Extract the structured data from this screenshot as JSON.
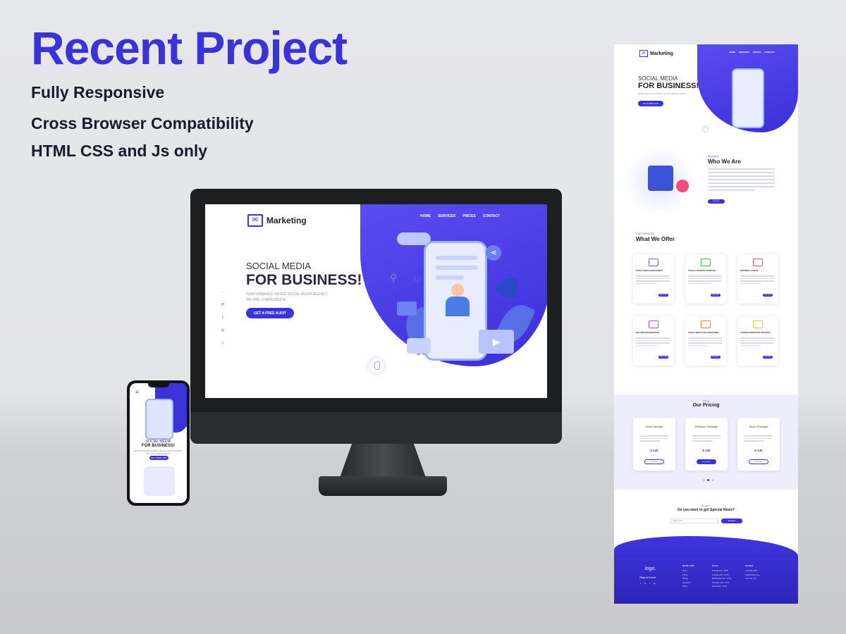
{
  "headline": "Recent Project",
  "features": [
    "Fully Responsive",
    "Cross Browser Compatibility",
    "HTML CSS and Js only"
  ],
  "colors": {
    "accent": "#3b32d8",
    "background": "#e6e7ea",
    "pricing_bg": "#eeedfd"
  },
  "desktop_site": {
    "logo_text": "Marketing",
    "logo_icon": "megaphone-box-icon",
    "nav": [
      "HOME",
      "SERVICES",
      "PRICES",
      "CONTACT"
    ],
    "kicker": "SOCIAL MEDIA",
    "headline": "FOR BUSINESS!",
    "sub1": "PERFORMANCE BASED SOCIAL MEDIA AGENCY",
    "sub2": "WE ARE LORRM MEDIA",
    "cta": "GET A FREE AUDIT",
    "social_icons": [
      "-",
      "P",
      "t",
      "◎",
      "|"
    ]
  },
  "mobile_site": {
    "kicker": "SOCIAL MEDIA",
    "headline": "FOR BUSINESS!",
    "sub1": "PERFORMANCE BASED SOCIAL MEDIA AGENCY",
    "sub2": "WE ARE LORRM MEDIA",
    "cta": "GET A FREE AUDIT"
  },
  "long_page": {
    "logo_text": "Marketing",
    "nav": [
      "HOME",
      "SERVICES",
      "PRICES",
      "CONTACT"
    ],
    "hero": {
      "kicker": "SOCIAL MEDIA",
      "headline": "FOR BUSINESS!",
      "sub": "PERFORMANCE BASED SOCIAL MEDIA AGENCY",
      "cta": "GET A FREE AUDIT"
    },
    "who": {
      "kicker": "Biography",
      "heading": "Who We Are",
      "button": "Read More"
    },
    "offer": {
      "kicker": "OUR SERVICES",
      "heading": "What We Offer",
      "cards": [
        {
          "title": "SOCIAL MEDIA MANAGEMENT",
          "color": "#6b5cf0",
          "button": "READ MORE"
        },
        {
          "title": "SOCIALS GROWTH CAMPAIGN",
          "color": "#3fb55d",
          "button": "READ MORE"
        },
        {
          "title": "BRANDING & MEDIA",
          "color": "#f04b7a",
          "button": "READ MORE"
        },
        {
          "title": "INFLUENCER MARKETING",
          "color": "#d646c7",
          "button": "READ MORE"
        },
        {
          "title": "SOCIAL MEDIA PAID ADVERTISING",
          "color": "#f07a3b",
          "button": "READ MORE"
        },
        {
          "title": "CONTENT MARKETING SERVICES",
          "color": "#f0b93b",
          "button": "READ MORE"
        }
      ]
    },
    "pricing": {
      "kicker": "Pricing",
      "heading": "Our Pricing",
      "plans": [
        {
          "name": "Gold Package",
          "price": "$ 140",
          "button": "See Details"
        },
        {
          "name": "Platinum Package",
          "price": "$ 140",
          "button": "See Details"
        },
        {
          "name": "Silver Package",
          "price": "$ 140",
          "button": "See Details"
        }
      ]
    },
    "newsletter": {
      "kicker": "Newsletter",
      "heading": "Do you want to get Special News?",
      "placeholder": "Enter email",
      "button": "Subscribe"
    },
    "footer": {
      "logo": "logo.",
      "stay": "Stay in touch",
      "social": [
        "f",
        "G",
        "t",
        "◎"
      ],
      "quick_title": "Quick Links",
      "quick_links": [
        "About",
        "Clients",
        "Pricing",
        "Newsletter",
        "Offers"
      ],
      "hours_title": "Hours",
      "hours": [
        "Monday  9:00 - 18:00",
        "Tuesday  9:00 - 18:00",
        "Wednesday  9:00 - 18:00",
        "Thursday  9:00 - 18:00",
        "Friday  9:00 - 18:00"
      ],
      "contact_title": "Contact",
      "contact": [
        "+123 456 7890",
        "info@website.com",
        "New York, US"
      ]
    }
  }
}
